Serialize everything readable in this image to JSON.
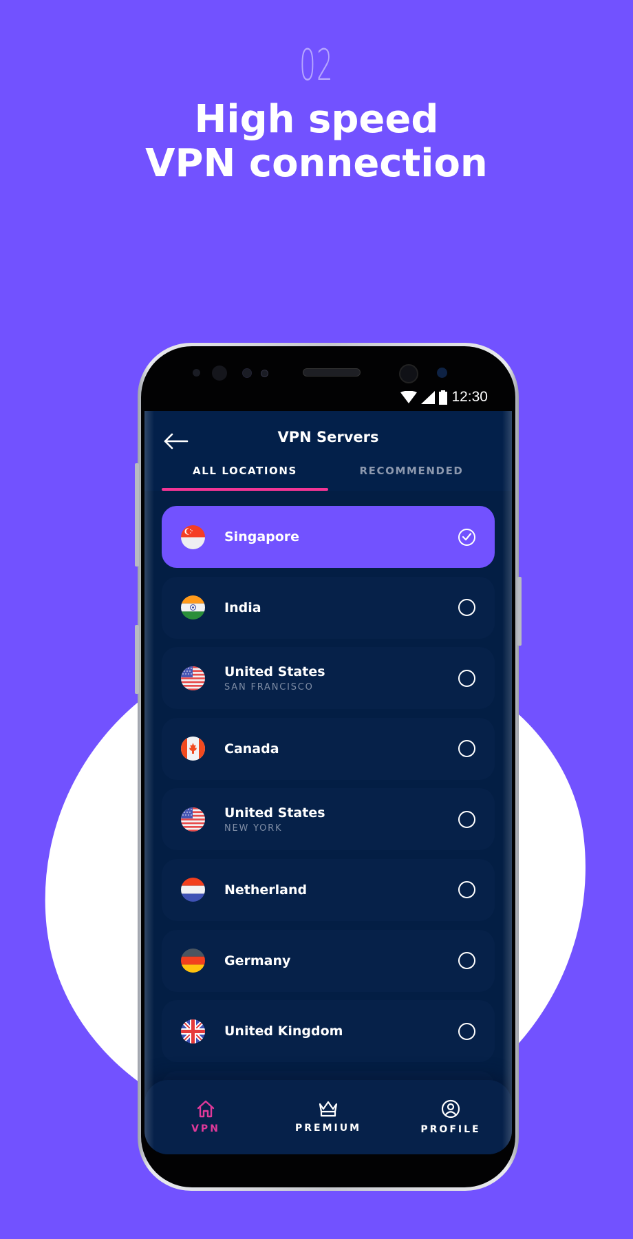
{
  "promo": {
    "step_number": "02",
    "headline_line1": "High speed",
    "headline_line2": "VPN connection"
  },
  "colors": {
    "background": "#7252FF",
    "screen": "#031E44",
    "card": "#062149",
    "selected_card": "#7252FF",
    "accent_pink": "#F33594"
  },
  "status_bar": {
    "time": "12:30",
    "icons": [
      "wifi-icon",
      "signal-icon",
      "battery-icon"
    ]
  },
  "app_bar": {
    "back_icon": "arrow-left-icon",
    "title": "VPN Servers"
  },
  "tabs": [
    {
      "label": "ALL LOCATIONS",
      "active": true
    },
    {
      "label": "RECOMMENDED",
      "active": false
    }
  ],
  "servers": [
    {
      "country": "Singapore",
      "city": "",
      "flag": "singapore",
      "selected": true
    },
    {
      "country": "India",
      "city": "",
      "flag": "india",
      "selected": false
    },
    {
      "country": "United States",
      "city": "SAN FRANCISCO",
      "flag": "usa",
      "selected": false
    },
    {
      "country": "Canada",
      "city": "",
      "flag": "canada",
      "selected": false
    },
    {
      "country": "United States",
      "city": "NEW YORK",
      "flag": "usa",
      "selected": false
    },
    {
      "country": "Netherland",
      "city": "",
      "flag": "netherlands",
      "selected": false
    },
    {
      "country": "Germany",
      "city": "",
      "flag": "germany",
      "selected": false
    },
    {
      "country": "United Kingdom",
      "city": "",
      "flag": "uk",
      "selected": false
    }
  ],
  "bottom_nav": [
    {
      "label": "VPN",
      "icon": "home-icon",
      "active": true
    },
    {
      "label": "PREMIUM",
      "icon": "crown-icon",
      "active": false
    },
    {
      "label": "PROFILE",
      "icon": "user-circle-icon",
      "active": false
    }
  ]
}
